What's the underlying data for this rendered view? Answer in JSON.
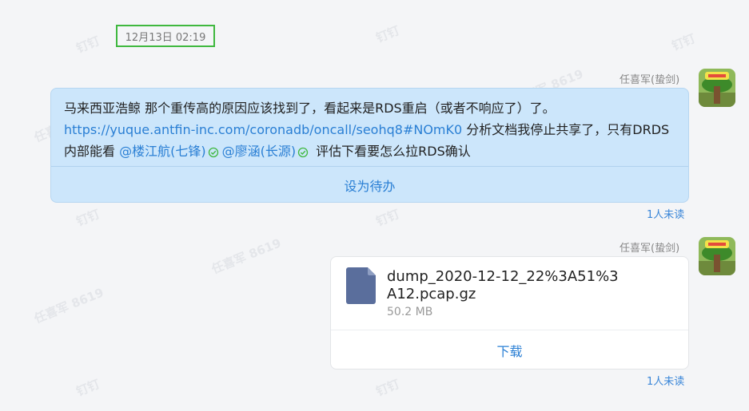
{
  "watermark": {
    "name": "任喜军 8619",
    "app": "钉钉"
  },
  "timestamp": "12月13日 02:19",
  "messages": [
    {
      "sender": "任喜军(蛰剑)",
      "text_part1": "马来西亚浩鲸 那个重传高的原因应该找到了，看起来是RDS重启（或者不响应了）了。",
      "link": "https://yuque.antfin-inc.com/coronadb/oncall/seohq8#NOmK0",
      "text_part2": " 分析文档我停止共享了，只有DRDS内部能看 ",
      "mention1": "@楼江航(七锋)",
      "mention2": "@廖涵(长源)",
      "text_part3": " 评估下看要怎么拉RDS确认",
      "action_label": "设为待办",
      "unread": "1人未读"
    },
    {
      "sender": "任喜军(蛰剑)",
      "file_name": "dump_2020-12-12_22%3A51%3A12.pcap.gz",
      "file_size": "50.2 MB",
      "action_label": "下载",
      "unread": "1人未读"
    }
  ],
  "colors": {
    "accent": "#2a7fd4",
    "bubble": "#cce6fb",
    "highlight": "#3fb83f"
  },
  "icons": {
    "check": "check-circle-icon",
    "file": "file-icon",
    "avatar": "avatar-image"
  }
}
